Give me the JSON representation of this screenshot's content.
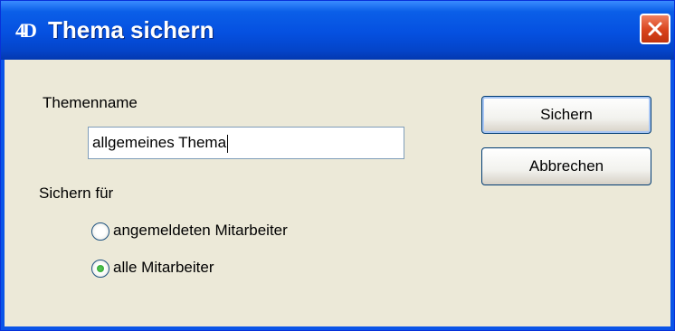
{
  "window": {
    "title": "Thema sichern",
    "app_icon_text": "4D",
    "close_icon": "close-icon"
  },
  "form": {
    "theme_name_label": "Themenname",
    "theme_name_value": "allgemeines Thema",
    "save_for_label": "Sichern für",
    "options": [
      {
        "label": "angemeldeten Mitarbeiter",
        "selected": false
      },
      {
        "label": "alle Mitarbeiter",
        "selected": true
      }
    ]
  },
  "buttons": {
    "save_label": "Sichern",
    "cancel_label": "Abbrechen"
  },
  "colors": {
    "titlebar": "#0550e0",
    "client_bg": "#ece9d8",
    "close_button": "#d8431c",
    "radio_dot": "#21a121"
  }
}
